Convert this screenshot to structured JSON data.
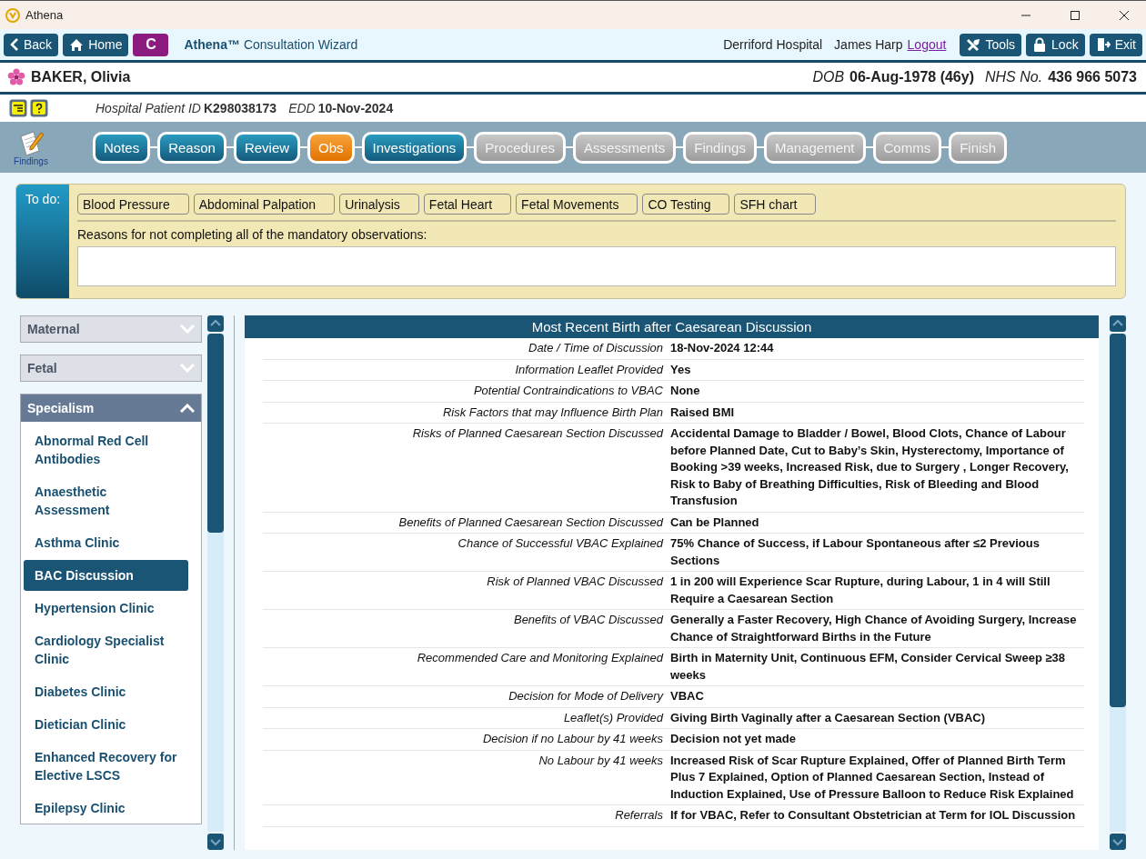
{
  "window": {
    "title": "Athena"
  },
  "toolbar": {
    "back": "Back",
    "home": "Home",
    "c_badge": "C",
    "app_name": "Athena™",
    "app_subtitle": "Consultation Wizard",
    "hospital": "Derriford Hospital",
    "user": "James Harp",
    "logout": "Logout",
    "buttons": [
      {
        "kind": "tools",
        "label": "Tools"
      },
      {
        "kind": "lock",
        "label": "Lock"
      },
      {
        "kind": "exit",
        "label": "Exit"
      }
    ]
  },
  "patient": {
    "name": "BAKER, Olivia",
    "dob_label": "DOB",
    "dob": "06-Aug-1978 (46y)",
    "nhs_label": "NHS No.",
    "nhs": "436 966 5073",
    "hospital_id_label": "Hospital Patient ID",
    "hospital_id": "K298038173",
    "edd_label": "EDD",
    "edd": "10-Nov-2024"
  },
  "findings_label": "Findings",
  "steps": [
    {
      "label": "Notes",
      "kind": "done"
    },
    {
      "label": "Reason",
      "kind": "done"
    },
    {
      "label": "Review",
      "kind": "done"
    },
    {
      "label": "Obs",
      "kind": "current"
    },
    {
      "label": "Investigations",
      "kind": "done"
    },
    {
      "label": "Procedures",
      "kind": "pending"
    },
    {
      "label": "Assessments",
      "kind": "pending"
    },
    {
      "label": "Findings",
      "kind": "pending"
    },
    {
      "label": "Management",
      "kind": "pending"
    },
    {
      "label": "Comms",
      "kind": "pending"
    },
    {
      "label": "Finish",
      "kind": "pending"
    }
  ],
  "todo": {
    "title": "To do:",
    "items": [
      "Blood Pressure",
      "Abdominal Palpation",
      "Urinalysis",
      "Fetal Heart",
      "Fetal Movements",
      "CO Testing",
      "SFH chart"
    ],
    "reasons_label": "Reasons for not completing all of the mandatory observations:"
  },
  "sidebar": {
    "sections": [
      {
        "label": "Maternal",
        "expanded": false
      },
      {
        "label": "Fetal",
        "expanded": false
      },
      {
        "label": "Specialism",
        "expanded": true,
        "children": [
          {
            "label": "Abnormal Red Cell Antibodies",
            "selected": false
          },
          {
            "label": "Anaesthetic Assessment",
            "selected": false
          },
          {
            "label": "Asthma Clinic",
            "selected": false
          },
          {
            "label": "BAC Discussion",
            "selected": true
          },
          {
            "label": "Hypertension Clinic",
            "selected": false
          },
          {
            "label": "Cardiology Specialist Clinic",
            "selected": false
          },
          {
            "label": "Diabetes Clinic",
            "selected": false
          },
          {
            "label": "Dietician Clinic",
            "selected": false
          },
          {
            "label": "Enhanced Recovery for Elective LSCS",
            "selected": false
          },
          {
            "label": "Epilepsy Clinic",
            "selected": false
          }
        ]
      }
    ]
  },
  "details": {
    "title": "Most Recent Birth after Caesarean Discussion",
    "rows": [
      {
        "label": "Date / Time of Discussion",
        "value": "18-Nov-2024 12:44"
      },
      {
        "label": "Information Leaflet Provided",
        "value": "Yes"
      },
      {
        "label": "Potential Contraindications to VBAC",
        "value": "None"
      },
      {
        "label": "Risk Factors that may Influence Birth Plan",
        "value": "Raised BMI"
      },
      {
        "label": "Risks of Planned Caesarean Section Discussed",
        "value": "Accidental Damage to Bladder / Bowel, Blood Clots, Chance of Labour before Planned Date, Cut to Baby’s Skin, Hysterectomy, Importance of Booking >39 weeks, Increased Risk, due to Surgery , Longer Recovery, Risk to Baby of Breathing Difficulties, Risk of Bleeding and Blood Transfusion"
      },
      {
        "label": "Benefits of Planned Caesarean Section Discussed",
        "value": "Can be Planned"
      },
      {
        "label": "Chance of Successful VBAC Explained",
        "value": "75% Chance of Success, if Labour Spontaneous after ≤2 Previous Sections"
      },
      {
        "label": "Risk of Planned VBAC Discussed",
        "value": "1 in 200 will Experience Scar Rupture, during Labour, 1 in 4 will Still Require a Caesarean Section"
      },
      {
        "label": "Benefits of VBAC Discussed",
        "value": "Generally a Faster Recovery, High Chance of Avoiding Surgery, Increase Chance of Straightforward Births in the Future"
      },
      {
        "label": "Recommended Care and Monitoring Explained",
        "value": "Birth in Maternity Unit, Continuous EFM, Consider Cervical Sweep ≥38 weeks"
      },
      {
        "label": "Decision for Mode of Delivery",
        "value": "VBAC"
      },
      {
        "label": "Leaflet(s) Provided",
        "value": "Giving Birth Vaginally after a Caesarean Section (VBAC)"
      },
      {
        "label": "Decision if no Labour by 41 weeks",
        "value": "Decision not yet made"
      },
      {
        "label": "No Labour by 41 weeks",
        "value": "Increased Risk of Scar Rupture Explained, Offer of Planned Birth Term Plus 7 Explained, Option of Planned Caesarean Section, Instead of Induction Explained, Use of Pressure Balloon to Reduce Risk Explained"
      },
      {
        "label": "Referrals",
        "value": "If for VBAC, Refer to Consultant Obstetrician at Term for IOL Discussion"
      }
    ]
  }
}
